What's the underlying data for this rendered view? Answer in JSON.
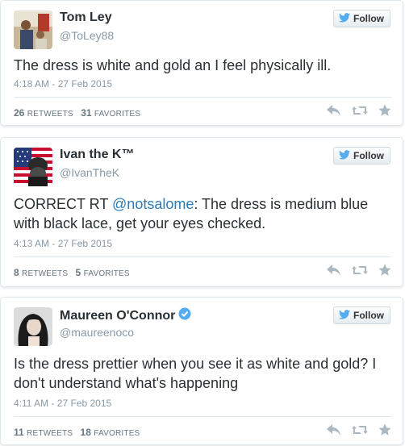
{
  "follow_label": "Follow",
  "colors": {
    "link": "#2b7bb9",
    "twitter_blue": "#55acee",
    "muted": "#8899a6"
  },
  "tweets": [
    {
      "name": "Tom Ley",
      "handle": "@ToLey88",
      "verified": false,
      "text_parts": [
        "The dress is white and gold an I feel physically ill."
      ],
      "time": "4:18 AM - 27 Feb 2015",
      "retweets": "26",
      "retweets_label": "RETWEETS",
      "favorites": "31",
      "favorites_label": "FAVORITES"
    },
    {
      "name": "Ivan the K™",
      "handle": "@IvanTheK",
      "verified": false,
      "text_parts": [
        "CORRECT RT ",
        "@notsalome",
        ": The dress is medium blue with black lace, get your eyes checked."
      ],
      "time": "4:13 AM - 27 Feb 2015",
      "retweets": "8",
      "retweets_label": "RETWEETS",
      "favorites": "5",
      "favorites_label": "FAVORITES"
    },
    {
      "name": "Maureen O'Connor",
      "handle": "@maureenoco",
      "verified": true,
      "text_parts": [
        "Is the dress prettier when you see it as white and gold? I don't understand what's happening"
      ],
      "time": "4:11 AM - 27 Feb 2015",
      "retweets": "11",
      "retweets_label": "RETWEETS",
      "favorites": "18",
      "favorites_label": "FAVORITES"
    }
  ]
}
